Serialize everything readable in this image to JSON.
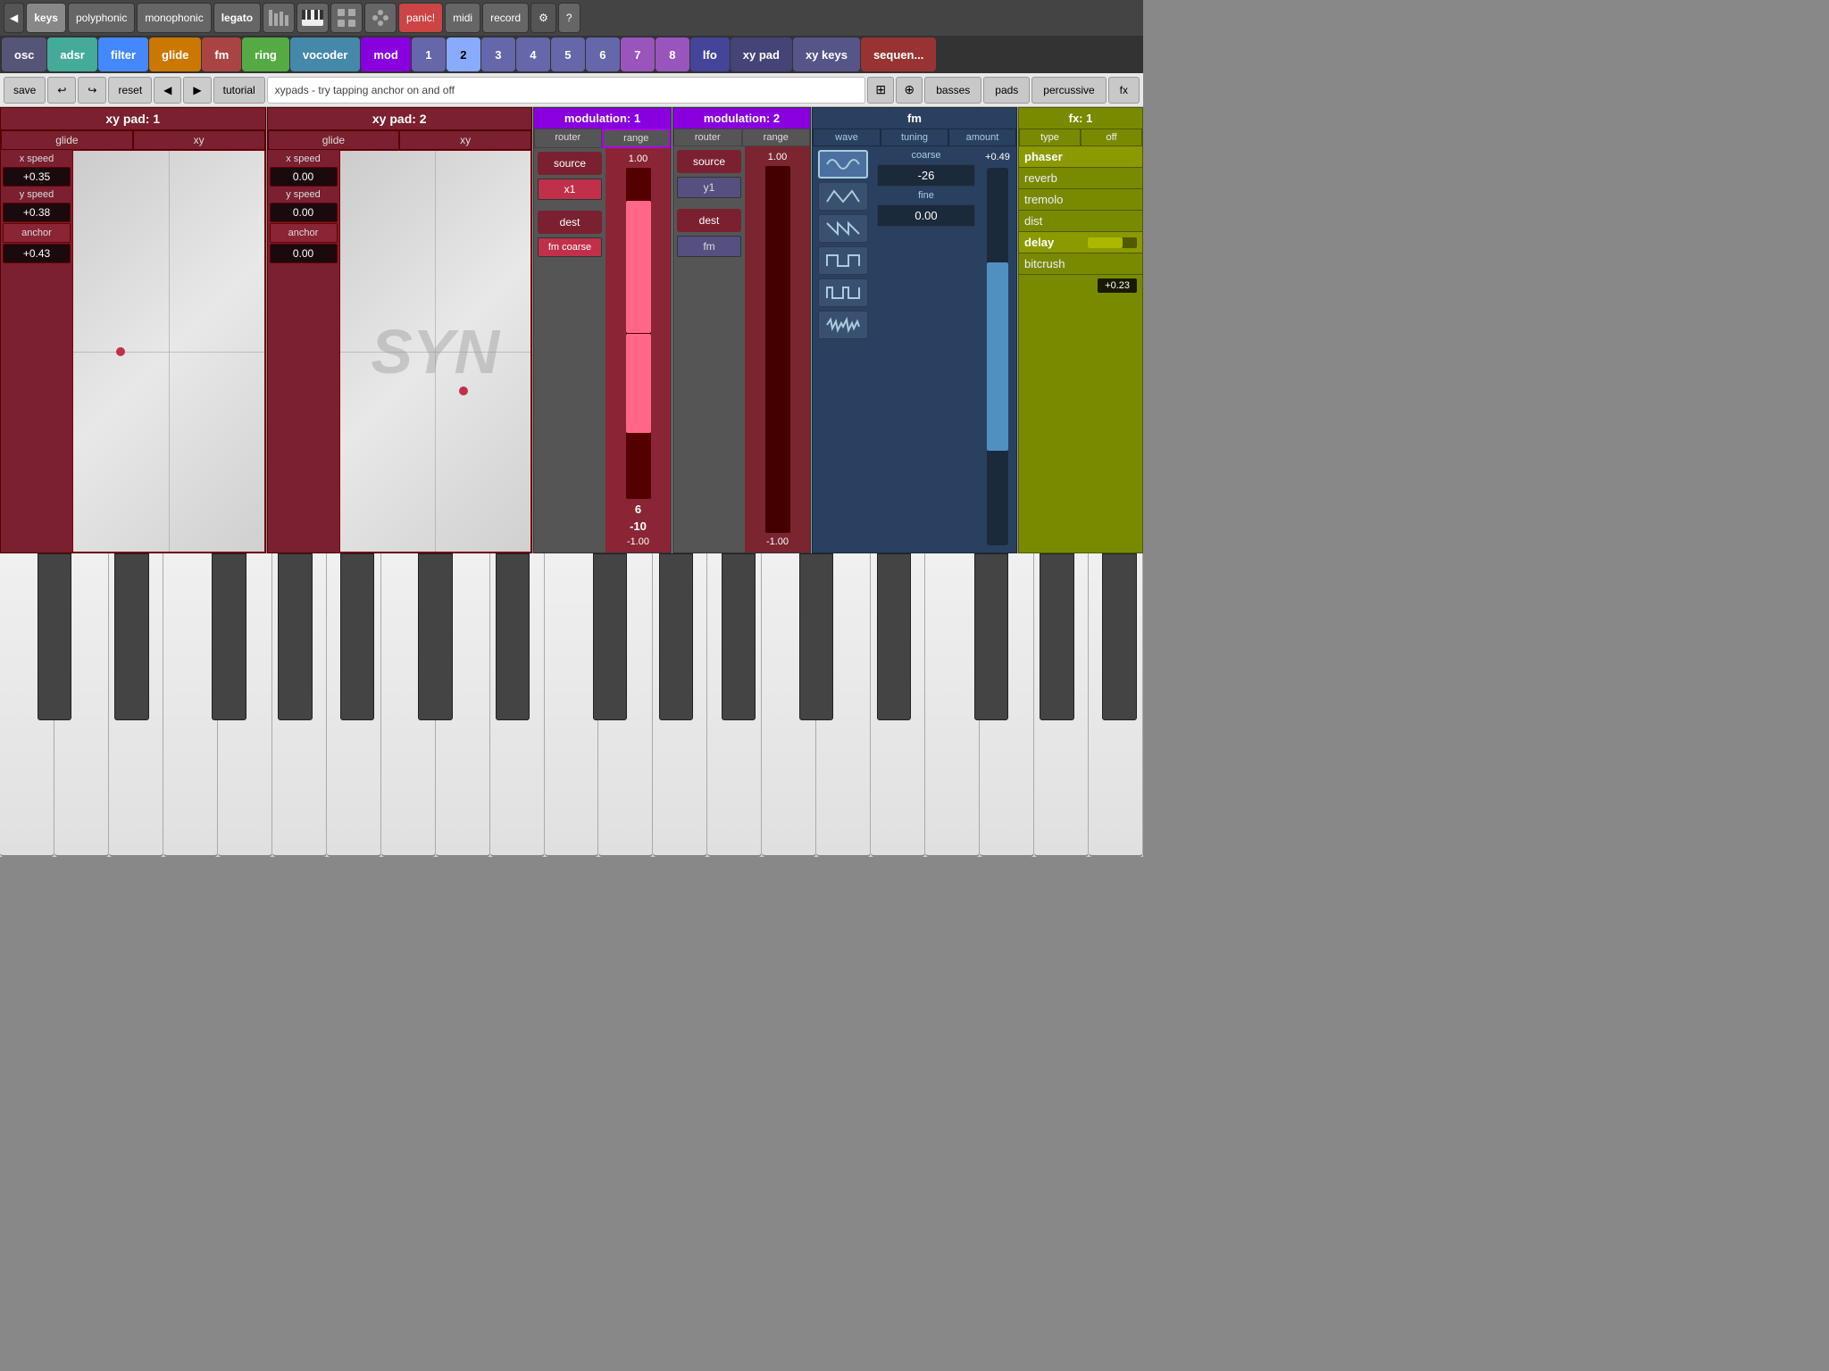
{
  "topNav": {
    "backLabel": "◀",
    "buttons": [
      "keys",
      "polyphonic",
      "monophonic",
      "legato",
      "📊",
      "🎹",
      "⚡",
      "🎵"
    ],
    "keysActive": "keys",
    "panicLabel": "panic!",
    "midiLabel": "midi",
    "recordLabel": "record",
    "gearLabel": "⚙",
    "questionLabel": "?"
  },
  "synthTabs": {
    "tabs": [
      {
        "id": "osc",
        "label": "osc",
        "color": "#557799"
      },
      {
        "id": "adsr",
        "label": "adsr",
        "color": "#44aa88"
      },
      {
        "id": "filter",
        "label": "filter",
        "color": "#4488ff"
      },
      {
        "id": "glide",
        "label": "glide",
        "color": "#cc7700"
      },
      {
        "id": "fm",
        "label": "fm",
        "color": "#aa4444"
      },
      {
        "id": "ring",
        "label": "ring",
        "color": "#558844"
      },
      {
        "id": "vocoder",
        "label": "vocoder",
        "color": "#4488aa"
      },
      {
        "id": "mod",
        "label": "mod",
        "color": "#8800dd"
      },
      {
        "id": "n1",
        "label": "1",
        "color": "#6666aa"
      },
      {
        "id": "n2",
        "label": "2",
        "color": "#6666aa"
      },
      {
        "id": "n3",
        "label": "3",
        "color": "#6666aa"
      },
      {
        "id": "n4",
        "label": "4",
        "color": "#6666aa"
      },
      {
        "id": "n5",
        "label": "5",
        "color": "#6666aa"
      },
      {
        "id": "n6",
        "label": "6",
        "color": "#6666aa"
      },
      {
        "id": "n7",
        "label": "7",
        "color": "#9955bb"
      },
      {
        "id": "n8",
        "label": "8",
        "color": "#9955bb"
      },
      {
        "id": "lfo",
        "label": "lfo",
        "color": "#444499"
      },
      {
        "id": "xypad",
        "label": "xy pad",
        "color": "#444477"
      },
      {
        "id": "xykeys",
        "label": "xy keys",
        "color": "#555588"
      },
      {
        "id": "seq",
        "label": "sequen...",
        "color": "#993333"
      }
    ]
  },
  "toolbar": {
    "saveLabel": "save",
    "undoLabel": "↩",
    "redoLabel": "↪",
    "resetLabel": "reset",
    "prevLabel": "◀",
    "nextLabel": "▶",
    "tutorialLabel": "tutorial",
    "message": "xypads - try tapping anchor on and off",
    "bassesLabel": "basses",
    "padsLabel": "pads",
    "percussiveLabel": "percussive",
    "fxLabel": "fx"
  },
  "xyPad1": {
    "header": "xy pad: 1",
    "glideLabel": "glide",
    "xyLabel": "xy",
    "xSpeedLabel": "x speed",
    "xSpeedValue": "+0.35",
    "ySpeedLabel": "y speed",
    "ySpeedValue": "+0.38",
    "anchorLabel": "anchor",
    "anchorValue": "+0.43",
    "cursorX": "25%",
    "cursorY": "50%"
  },
  "xyPad2": {
    "header": "xy pad: 2",
    "glideLabel": "glide",
    "xyLabel": "xy",
    "xSpeedLabel": "x speed",
    "xSpeedValue": "0.00",
    "ySpeedLabel": "y speed",
    "ySpeedValue": "0.00",
    "anchorLabel": "anchor",
    "anchorValue": "0.00",
    "cursorX": "65%",
    "cursorY": "60%",
    "watermark": "SYN"
  },
  "modulation1": {
    "header": "modulation: 1",
    "routerLabel": "router",
    "rangeLabel": "range",
    "sourceLabel": "source",
    "sourceValue": "x1",
    "destLabel": "dest",
    "destValue": "fm coarse",
    "rangeTop": "1.00",
    "rangeVal": "6",
    "rangeValBot": "-10",
    "rangeBot": "-1.00"
  },
  "modulation2": {
    "header": "modulation: 2",
    "routerLabel": "router",
    "rangeLabel": "range",
    "sourceLabel": "source",
    "sourceValue": "y1",
    "destLabel": "dest",
    "destValue": "fm",
    "rangeTop": "1.00",
    "rangeBot": "-1.00"
  },
  "fm": {
    "header": "fm",
    "waveLabel": "wave",
    "tuningLabel": "tuning",
    "amountLabel": "amount",
    "coarseLabel": "coarse",
    "coarseValue": "-26",
    "fineLabel": "fine",
    "fineValue": "0.00",
    "amountValue": "+0.49",
    "waves": [
      "sine",
      "triangle",
      "sawtooth",
      "square",
      "pulse",
      "noise"
    ]
  },
  "fx": {
    "header": "fx: 1",
    "typeLabel": "type",
    "offLabel": "off",
    "offValue": "+0.23",
    "items": [
      {
        "id": "phaser",
        "label": "phaser",
        "active": true
      },
      {
        "id": "reverb",
        "label": "reverb",
        "active": false
      },
      {
        "id": "tremolo",
        "label": "tremolo",
        "active": false
      },
      {
        "id": "dist",
        "label": "dist",
        "active": false
      },
      {
        "id": "delay",
        "label": "delay",
        "active": true,
        "sliderVal": 0.7
      },
      {
        "id": "bitcrush",
        "label": "bitcrush",
        "active": false
      }
    ]
  },
  "piano": {
    "whiteKeyCount": 21
  }
}
